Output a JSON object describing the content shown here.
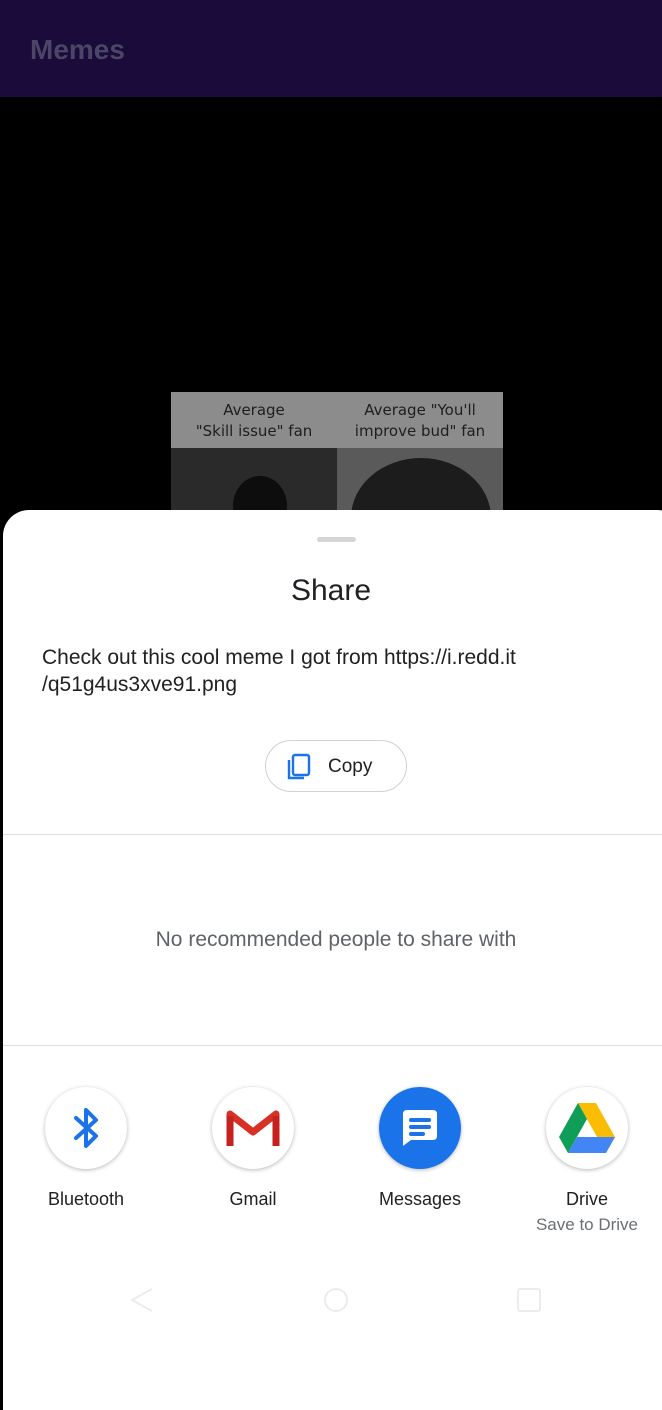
{
  "app": {
    "title": "Memes"
  },
  "meme": {
    "caption_left": "Average\n\"Skill issue\" fan",
    "caption_right": "Average \"You'll\nimprove bud\" fan"
  },
  "share": {
    "title": "Share",
    "text": "Check out this cool meme I got from https://i.redd.it\n/q51g4us3xve91.png",
    "copy_label": "Copy",
    "empty_people": "No recommended people to share with"
  },
  "targets": [
    {
      "label": "Bluetooth",
      "icon": "bluetooth-icon"
    },
    {
      "label": "Gmail",
      "icon": "gmail-icon"
    },
    {
      "label": "Messages",
      "icon": "messages-icon"
    },
    {
      "label": "Drive",
      "sublabel": "Save to Drive",
      "icon": "drive-icon"
    }
  ],
  "colors": {
    "appbar": "#1a0b3b",
    "accent_blue": "#1a73e8"
  }
}
